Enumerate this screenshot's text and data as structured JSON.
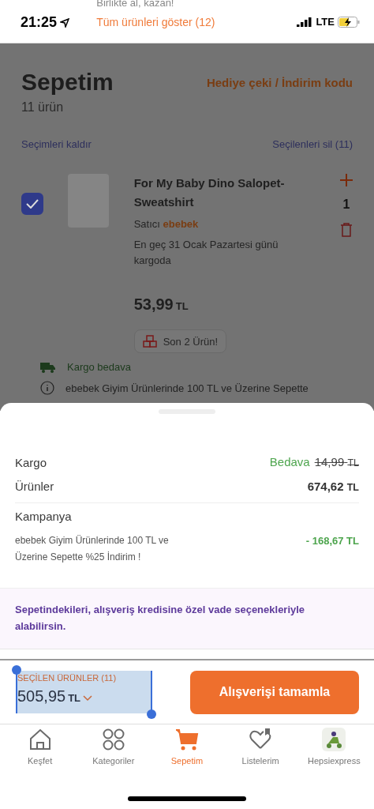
{
  "status_bar": {
    "time": "21:25",
    "network": "LTE"
  },
  "banner": {
    "caption": "Birlikte al, kazan!",
    "link": "Tüm ürünleri göster (12)"
  },
  "cart": {
    "title": "Sepetim",
    "count": "11 ürün",
    "coupon_link": "Hediye çeki / İndirim kodu",
    "deselect_link": "Seçimleri kaldır",
    "delete_link": "Seçilenleri sil (11)",
    "item": {
      "checked": true,
      "name": "For My Baby Dino Salopet-Sweatshirt",
      "seller_label": "Satıcı",
      "seller": "ebebek",
      "delivery": "En geç 31 Ocak Pazartesi günü kargoda",
      "price": "53,99",
      "currency": "TL",
      "quantity": "1",
      "stock_badge": "Son 2 Ürün!"
    },
    "shipping_note": "Kargo bedava",
    "campaign_note": "ebebek Giyim Ürünlerinde 100 TL ve Üzerine Sepette"
  },
  "summary": {
    "rows": [
      {
        "label": "Kargo",
        "value": "Bedava",
        "old_value": "14,99",
        "currency": "TL"
      },
      {
        "label": "Ürünler",
        "value": "674,62",
        "currency": "TL"
      }
    ],
    "campaign": {
      "title": "Kampanya",
      "description": "ebebek Giyim Ürünlerinde 100 TL ve Üzerine Sepette %25 İndirim !",
      "amount": "- 168,67 TL"
    },
    "credit_note": "Sepetindekileri, alışveriş kredisine özel vade seçenekleriyle alabilirsin."
  },
  "checkout": {
    "label": "SEÇİLEN ÜRÜNLER (11)",
    "total": "505,95",
    "currency": "TL",
    "button": "Alışverişi tamamla"
  },
  "tabs": [
    {
      "label": "Keşfet",
      "kind": "home",
      "selected": false
    },
    {
      "label": "Kategoriler",
      "kind": "grid",
      "selected": false
    },
    {
      "label": "Sepetim",
      "kind": "cart",
      "selected": true
    },
    {
      "label": "Listelerim",
      "kind": "heart",
      "selected": false
    },
    {
      "label": "Hepsiexpress",
      "kind": "express",
      "selected": false
    }
  ]
}
